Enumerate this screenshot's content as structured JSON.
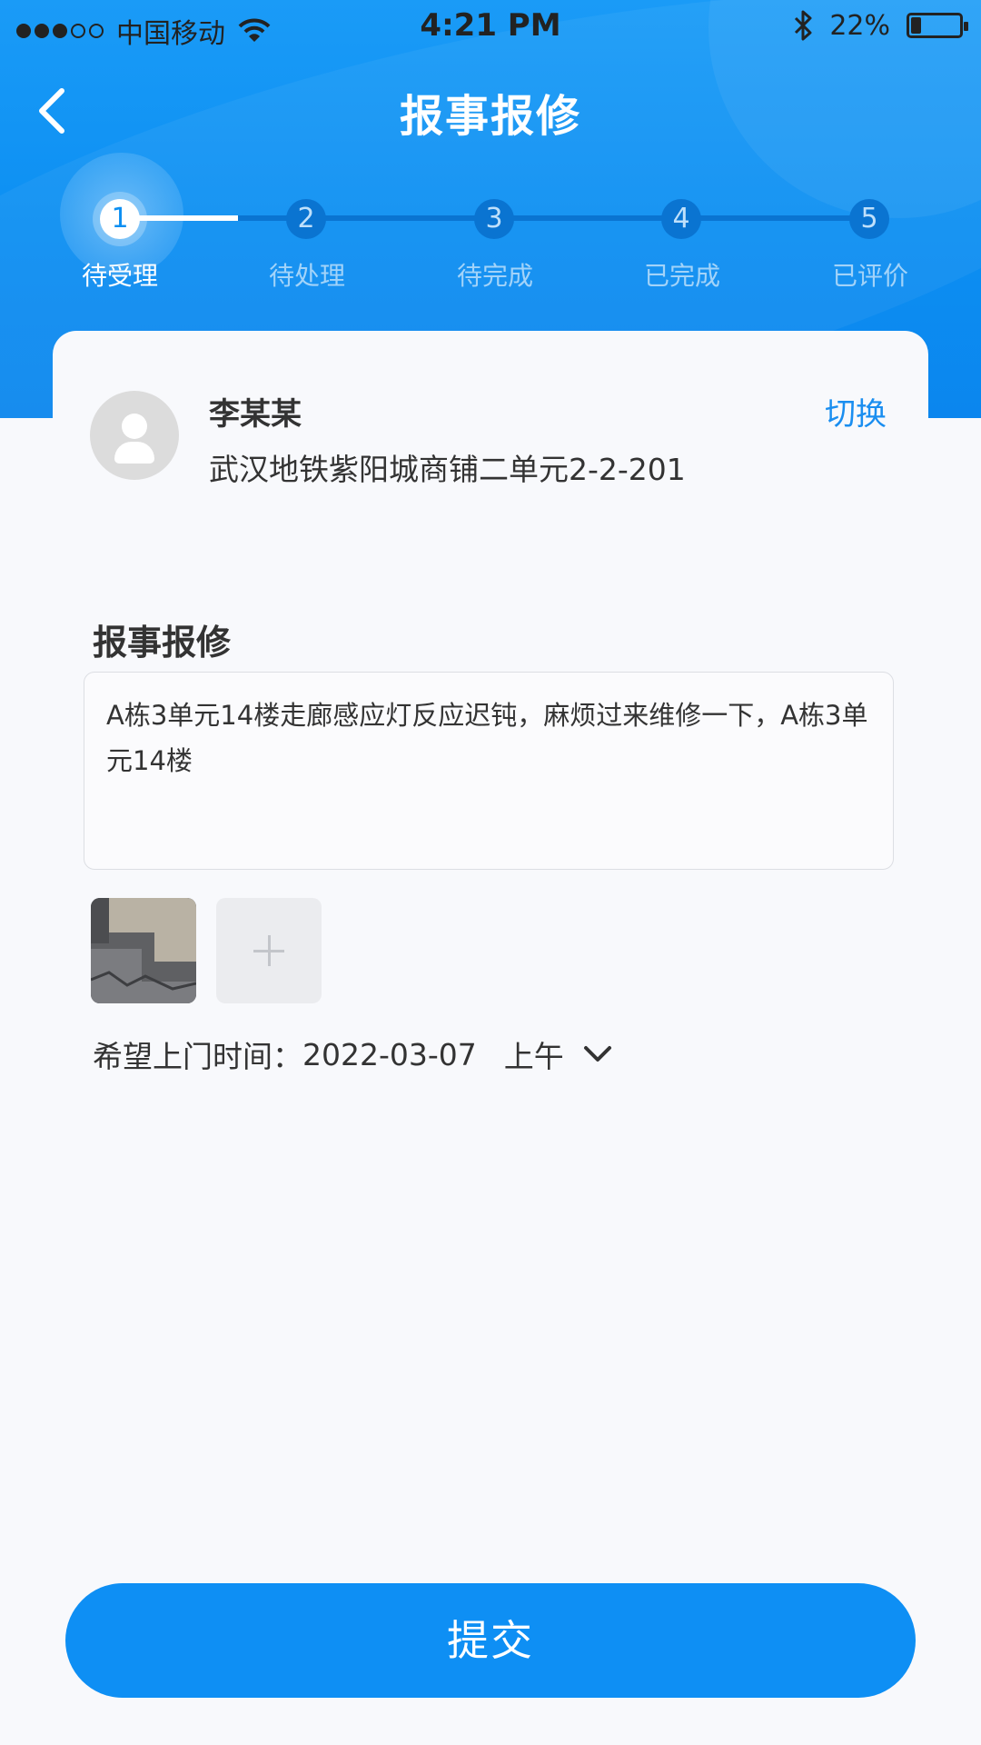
{
  "status_bar": {
    "carrier": "中国移动",
    "time": "4:21 PM",
    "battery_text": "22%",
    "battery_level": 0.22
  },
  "header": {
    "title": "报事报修",
    "back_icon": "chevron-left-icon"
  },
  "steps": [
    {
      "number": "1",
      "label": "待受理",
      "active": true
    },
    {
      "number": "2",
      "label": "待处理",
      "active": false
    },
    {
      "number": "3",
      "label": "待完成",
      "active": false
    },
    {
      "number": "4",
      "label": "已完成",
      "active": false
    },
    {
      "number": "5",
      "label": "已评价",
      "active": false
    }
  ],
  "user": {
    "name": "李某某",
    "address": "武汉地铁紫阳城商铺二单元2-2-201",
    "switch_label": "切换"
  },
  "form": {
    "section_title": "报事报修",
    "description": "A栋3单元14楼走廊感应灯反应迟钝，麻烦过来维修一下，A栋3单元14楼",
    "visit_label": "希望上门时间：",
    "visit_date": "2022-03-07",
    "visit_period": "上午"
  },
  "submit_label": "提交",
  "colors": {
    "primary": "#0e8ff4",
    "link": "#1a8ef0"
  }
}
